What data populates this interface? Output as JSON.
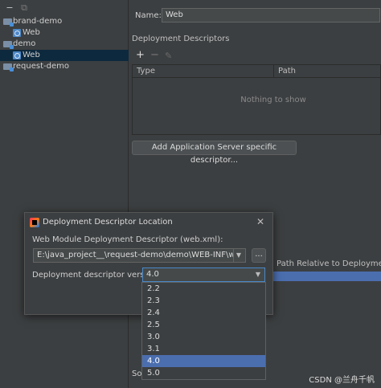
{
  "tree": {
    "toolbar": {
      "collapse_icon": "minus-icon",
      "copy_icon": "copy-icon"
    },
    "items": [
      {
        "label": "brand-demo",
        "icon": "module-folder-icon"
      },
      {
        "label": "Web",
        "icon": "web-facet-icon"
      },
      {
        "label": "demo",
        "icon": "module-folder-icon"
      },
      {
        "label": "Web",
        "icon": "web-facet-icon"
      },
      {
        "label": "request-demo",
        "icon": "module-folder-icon"
      }
    ]
  },
  "facet": {
    "name_label": "Name:",
    "name_value": "Web",
    "descriptors_title": "Deployment Descriptors",
    "descriptor_toolbar": {
      "add": "+",
      "remove": "−",
      "edit": "✎"
    },
    "table_columns": [
      "Type",
      "Path"
    ],
    "empty_text": "Nothing to show",
    "add_server_button": "Add Application Server specific descriptor...",
    "path_relative_header": "Path Relative to Deployment Ro",
    "source_prefix": "So"
  },
  "dialog": {
    "title": "Deployment Descriptor Location",
    "web_xml_label": "Web Module Deployment Descriptor (web.xml):",
    "path_value": "E:\\java_project__\\request-demo\\demo\\WEB-INF\\web.xml",
    "browse_label": "...",
    "version_label": "Deployment descriptor version",
    "version_value": "4.0",
    "close_icon": "close-icon"
  },
  "dropdown": {
    "options": [
      "2.2",
      "2.3",
      "2.4",
      "2.5",
      "3.0",
      "3.1",
      "4.0",
      "5.0"
    ],
    "selected": "4.0"
  },
  "watermark": "CSDN @兰舟千帆"
}
